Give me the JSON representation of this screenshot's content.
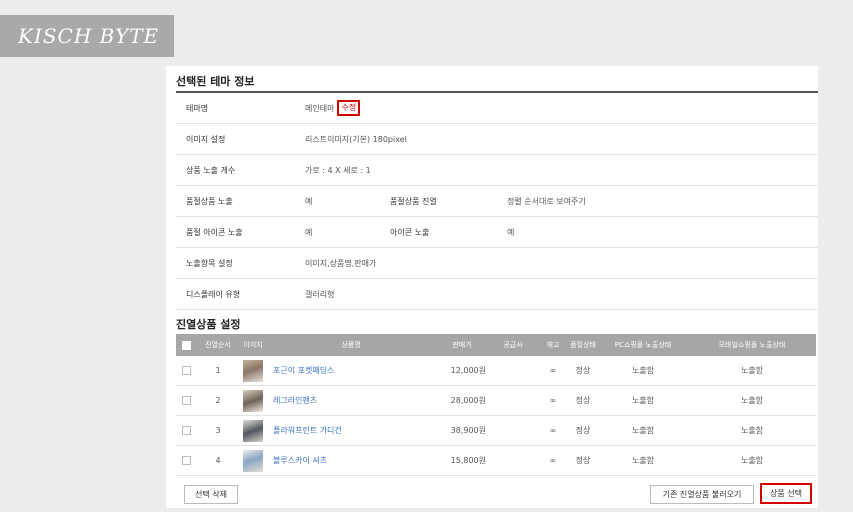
{
  "logo": {
    "text": "KISCH BYTE"
  },
  "theme_info": {
    "title": "선택된 테마 정보",
    "theme_name_label": "테마명",
    "theme_name_value": "메인테마",
    "edit_label": "수정",
    "image_setting_label": "이미지 설정",
    "image_setting_value": "리스트이미지(기본) 180pixel",
    "display_count_label": "상품 노출 개수",
    "display_count_value": "가로 : 4 X 세로 : 1",
    "soldout_display_label": "품절상품 노출",
    "soldout_display_value": "예",
    "soldout_order_label": "품절상품 진열",
    "soldout_order_value": "정렬 순서대로 보여주기",
    "soldout_icon_label": "품절 아이콘 노출",
    "soldout_icon_value": "예",
    "icon_display_label": "아이콘 노출",
    "icon_display_value": "예",
    "display_items_label": "노출항목 설정",
    "display_items_value": "이미지,상품명,판매가",
    "display_type_label": "디스플레이 유형",
    "display_type_value": "갤러리형"
  },
  "products": {
    "title": "진열상품 설정",
    "headers": {
      "order": "진열순서",
      "image": "이미지",
      "name": "상품명",
      "price": "판매가",
      "supplier": "공급사",
      "stock": "재고",
      "soldout_state": "품절상태",
      "pc_state": "PC쇼핑몰 노출상태",
      "mobile_state": "모바일쇼핑몰 노출상태"
    },
    "rows": [
      {
        "order": "1",
        "image_icon": "product-thumbnail",
        "name": "포근이 포켓패딩스",
        "price": "12,000원",
        "supplier": "",
        "stock": "∞",
        "soldout_state": "정상",
        "pc_state": "노출함",
        "mobile_state": "노출함"
      },
      {
        "order": "2",
        "image_icon": "product-thumbnail",
        "name": "레그라인팬츠",
        "price": "28,000원",
        "supplier": "",
        "stock": "∞",
        "soldout_state": "정상",
        "pc_state": "노출함",
        "mobile_state": "노출함"
      },
      {
        "order": "3",
        "image_icon": "product-thumbnail",
        "name": "플라워프린트 가디건",
        "price": "38,900원",
        "supplier": "",
        "stock": "∞",
        "soldout_state": "정상",
        "pc_state": "노출함",
        "mobile_state": "노출함"
      },
      {
        "order": "4",
        "image_icon": "product-thumbnail",
        "name": "블루스카이 셔츠",
        "price": "15,800원",
        "supplier": "",
        "stock": "∞",
        "soldout_state": "정상",
        "pc_state": "노출함",
        "mobile_state": "노출함"
      }
    ]
  },
  "actions": {
    "delete_selected": "선택 삭제",
    "load_existing": "기존 진열상품 불러오기",
    "select_products": "상품 선택"
  },
  "colors": {
    "highlight": "#d40000",
    "link": "#3b73c7",
    "header_bg": "#a6a6a6"
  }
}
